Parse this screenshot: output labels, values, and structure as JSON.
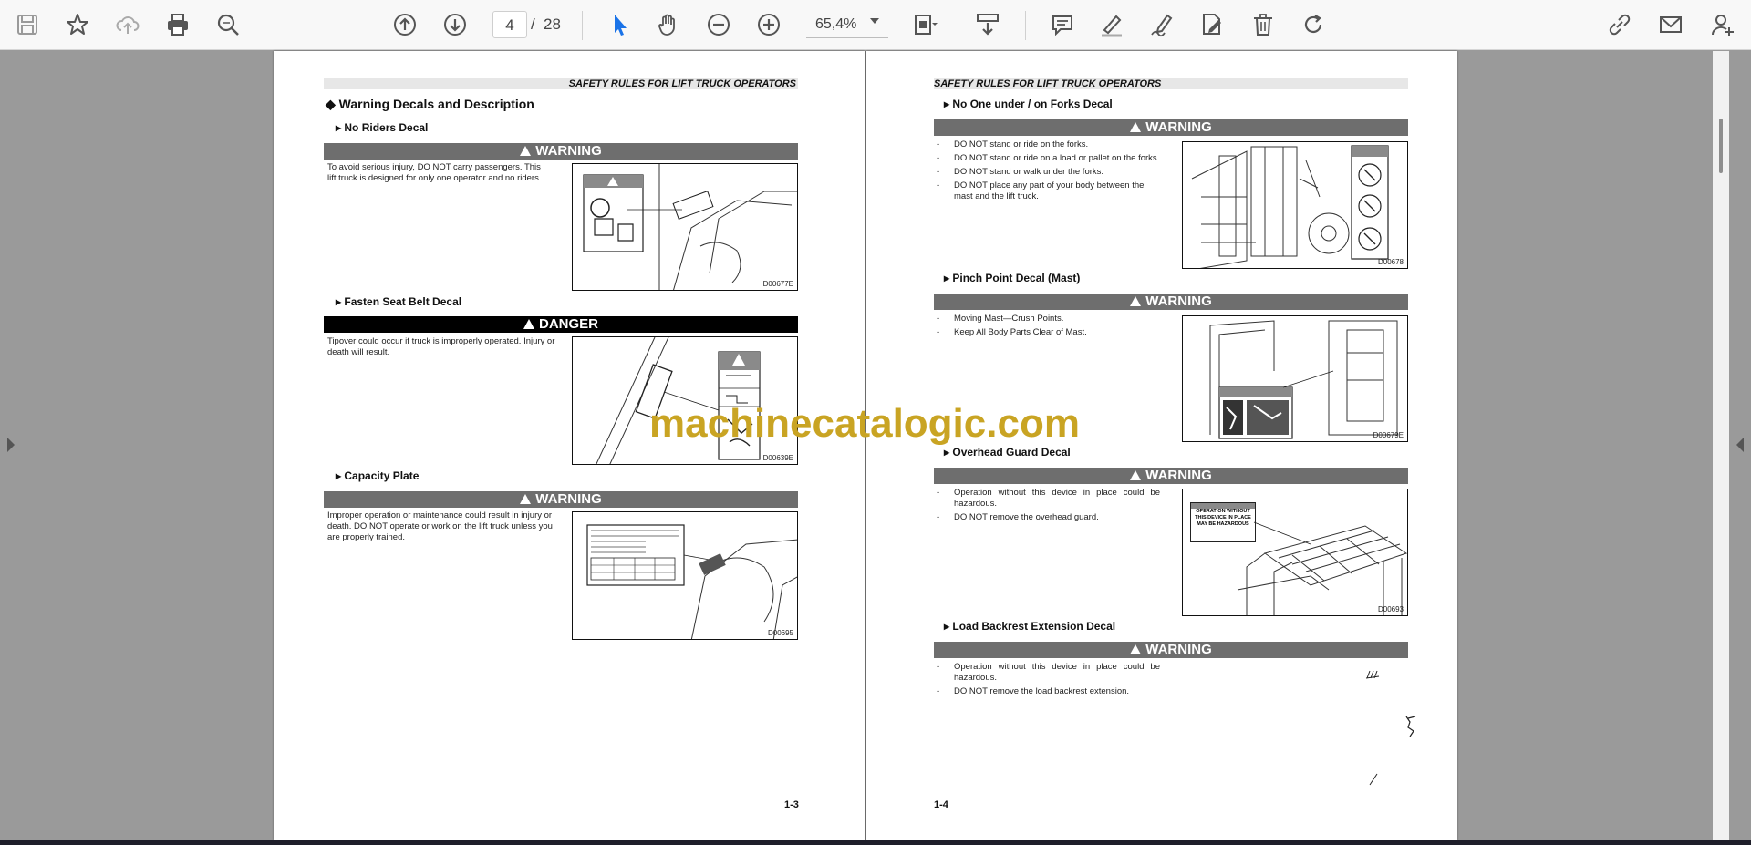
{
  "toolbar": {
    "page_current": "4",
    "page_separator": "/",
    "page_total": "28",
    "zoom": "65,4%",
    "icons": [
      "save-icon",
      "bookmark-star-icon",
      "upload-cloud-icon",
      "print-icon",
      "zoom-search-icon",
      "page-up-icon",
      "page-down-icon",
      "select-cursor-icon",
      "hand-tool-icon",
      "zoom-out-icon",
      "zoom-in-icon",
      "page-fit-icon",
      "scroll-mode-icon",
      "comment-icon",
      "highlight-pen-icon",
      "sign-icon",
      "edit-pdf-icon",
      "delete-icon",
      "rotate-icon",
      "share-link-icon",
      "email-icon",
      "add-user-icon"
    ]
  },
  "left_page": {
    "header": "SAFETY RULES FOR LIFT TRUCK OPERATORS",
    "section_title": "Warning Decals and Description",
    "blocks": [
      {
        "title": "No Riders Decal",
        "bar": "WARNING",
        "text": "To avoid serious injury, DO NOT carry passengers. This lift truck is designed for only one operator and no riders.",
        "figure_id": "D00677E"
      },
      {
        "title": "Fasten Seat Belt Decal",
        "bar": "DANGER",
        "text": "Tipover could occur if truck is improperly operated. Injury or death will result.",
        "figure_id": "D00639E"
      },
      {
        "title": "Capacity Plate",
        "bar": "WARNING",
        "text": "Improper operation or maintenance could result in injury or death. DO NOT operate or work on the lift truck unless you are properly trained.",
        "figure_id": "D00695"
      }
    ],
    "page_number": "1-3"
  },
  "right_page": {
    "header": "SAFETY RULES FOR LIFT TRUCK OPERATORS",
    "blocks": [
      {
        "title": "No One under / on Forks Decal",
        "bar": "WARNING",
        "bullets": [
          "DO NOT stand or ride on the forks.",
          "DO NOT stand or ride on a load or pallet on the forks.",
          "DO NOT stand or walk under the forks.",
          "DO NOT place any part of your body between the mast and the lift truck."
        ],
        "figure_id": "D00678"
      },
      {
        "title": "Pinch Point Decal (Mast)",
        "bar": "WARNING",
        "bullets": [
          "Moving Mast—Crush Points.",
          "Keep All Body Parts Clear of Mast."
        ],
        "figure_id": "D00679E"
      },
      {
        "title": "Overhead Guard Decal",
        "bar": "WARNING",
        "bullets": [
          "Operation without this device in place could be hazardous.",
          "DO NOT remove the overhead guard."
        ],
        "figure_id": "D00693",
        "figure_label": "OPERATION WITHOUT THIS DEVICE IN PLACE MAY BE HAZARDOUS"
      },
      {
        "title": "Load Backrest Extension Decal",
        "bar": "WARNING",
        "bullets": [
          "Operation without this device in place could be hazardous.",
          "DO NOT remove the load backrest extension."
        ]
      }
    ],
    "page_number": "1-4"
  },
  "watermark": "machinecatalogic.com",
  "colors": {
    "warning_bar": "#6e6e6e",
    "danger_bar": "#000000",
    "watermark": "#c9a423",
    "viewer_bg": "#9a9a9a",
    "select_accent": "#1a73e8"
  }
}
